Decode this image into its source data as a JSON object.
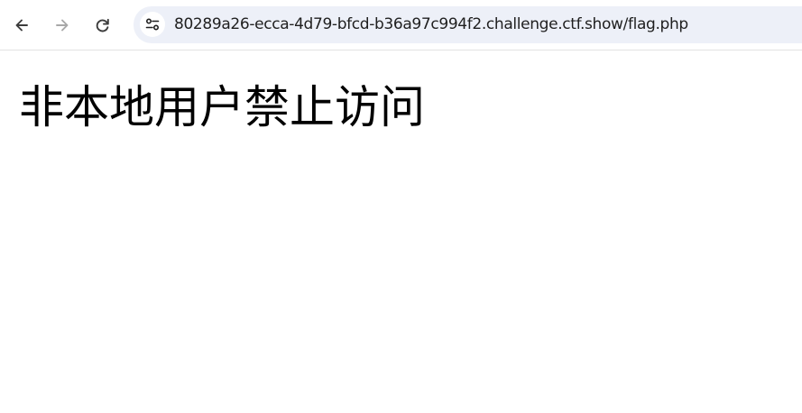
{
  "browser": {
    "address_bar": {
      "url": "80289a26-ecca-4d79-bfcd-b36a97c994f2.challenge.ctf.show/flag.php"
    },
    "icons": {
      "back": "arrow-left-icon",
      "forward": "arrow-right-icon",
      "reload": "reload-icon",
      "site_info": "tune-icon"
    },
    "colors": {
      "omnibox_bg": "#edf0f8",
      "forward_disabled": "#a8a8a8"
    }
  },
  "page": {
    "heading": "非本地用户禁止访问"
  }
}
